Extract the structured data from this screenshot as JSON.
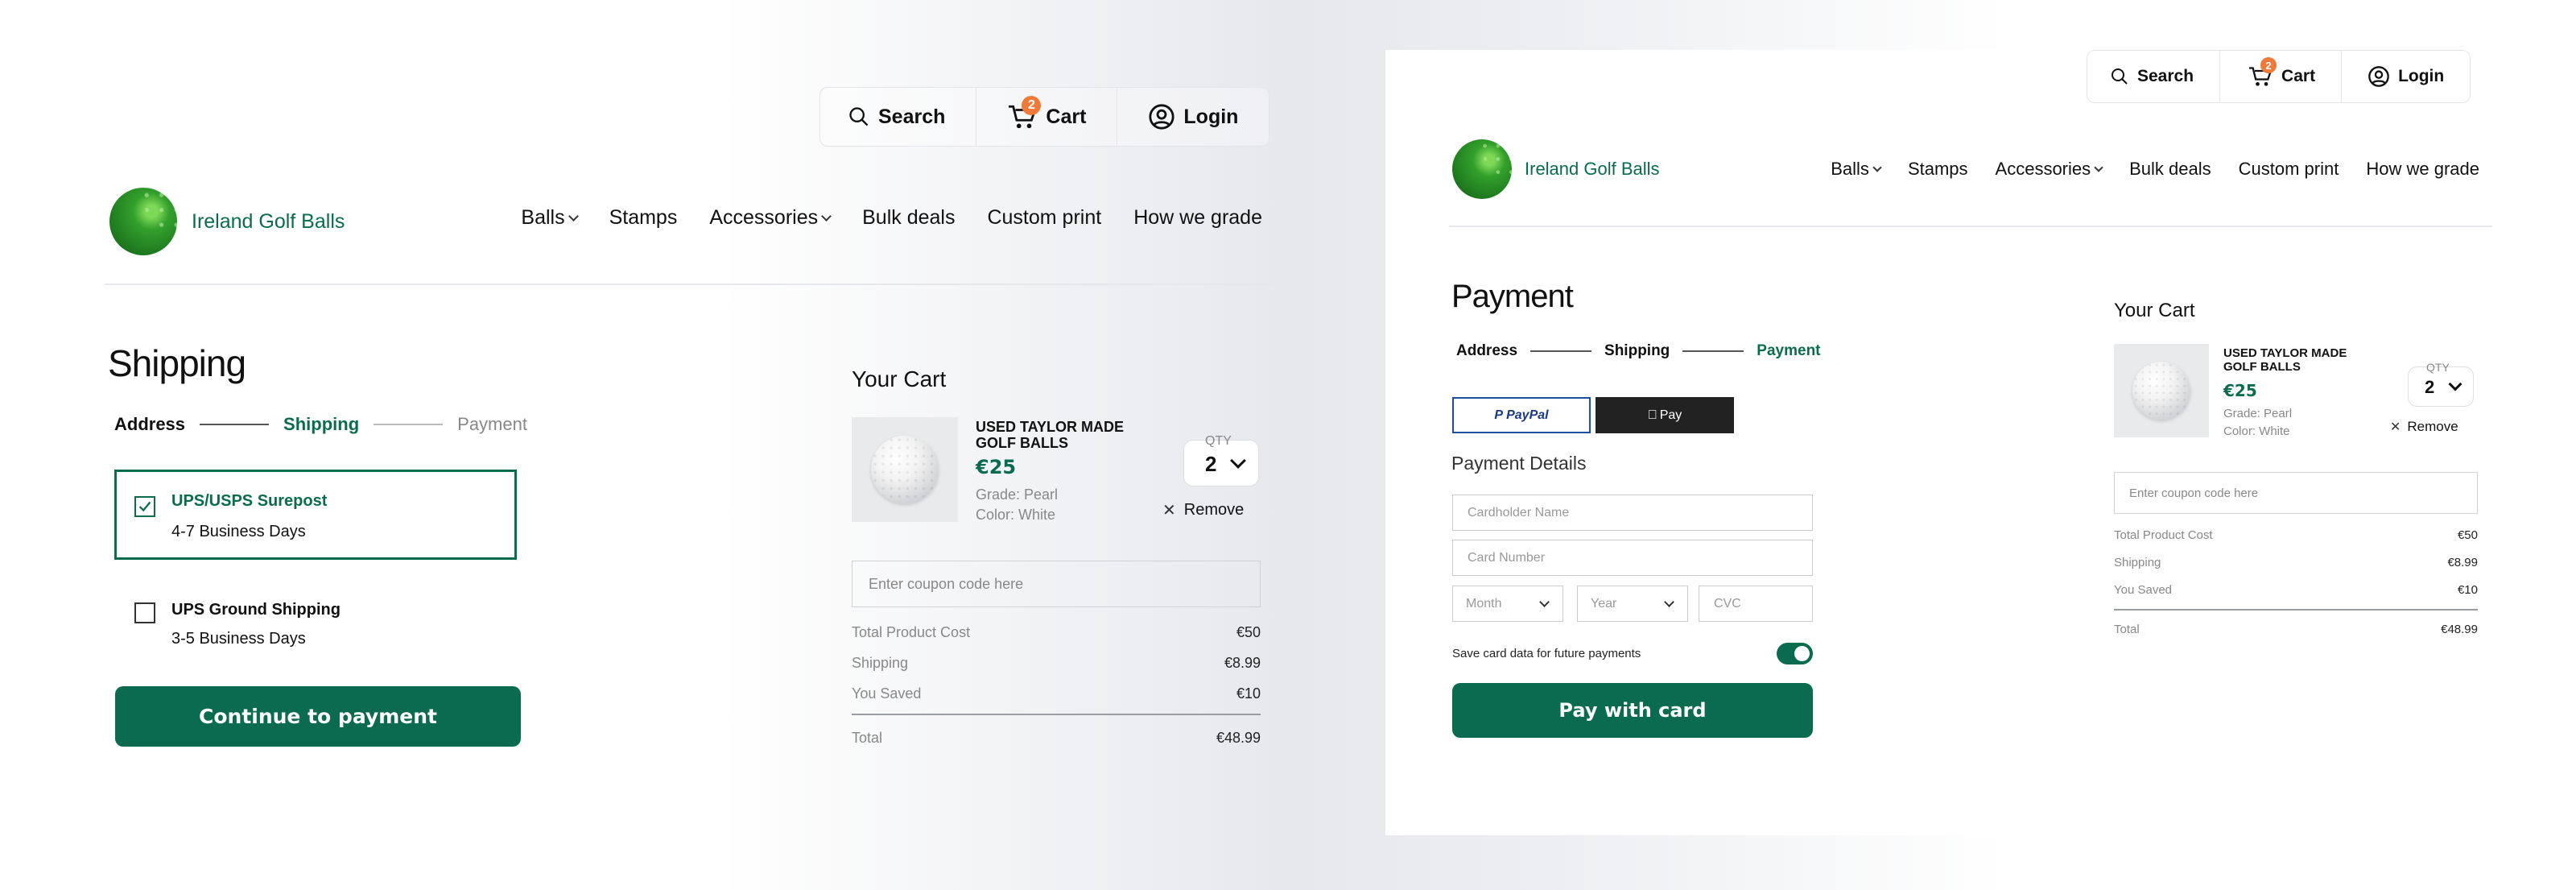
{
  "brand": {
    "name": "Ireland Golf Balls",
    "accent": "#0b6b4f",
    "badge_color": "#f07a3a"
  },
  "topbar": {
    "search": "Search",
    "cart": "Cart",
    "cart_count": "2",
    "login": "Login"
  },
  "nav": {
    "items": [
      {
        "label": "Balls",
        "dropdown": true
      },
      {
        "label": "Stamps",
        "dropdown": false
      },
      {
        "label": "Accessories",
        "dropdown": true
      },
      {
        "label": "Bulk deals",
        "dropdown": false
      },
      {
        "label": "Custom print",
        "dropdown": false
      },
      {
        "label": "How we grade",
        "dropdown": false
      }
    ]
  },
  "left": {
    "title": "Shipping",
    "steps": [
      "Address",
      "Shipping",
      "Payment"
    ],
    "options": [
      {
        "name": "UPS/USPS Surepost",
        "eta": "4-7 Business Days",
        "selected": true
      },
      {
        "name": "UPS Ground Shipping",
        "eta": "3-5 Business Days",
        "selected": false
      }
    ],
    "continue_label": "Continue to payment"
  },
  "cart": {
    "title": "Your Cart",
    "item": {
      "name": "USED TAYLOR MADE GOLF BALLS",
      "price": "€25",
      "grade": "Grade: Pearl",
      "color": "Color: White",
      "qty_label": "QTY",
      "qty": "2",
      "remove": "Remove"
    },
    "coupon_placeholder": "Enter coupon code here",
    "summary": {
      "total_product_cost_label": "Total Product Cost",
      "total_product_cost": "€50",
      "shipping_label": "Shipping",
      "shipping": "€8.99",
      "saved_label": "You Saved",
      "saved": "€10",
      "total_label": "Total",
      "total": "€48.99"
    }
  },
  "right": {
    "title": "Payment",
    "steps": [
      "Address",
      "Shipping",
      "Payment"
    ],
    "paypal": "PayPal",
    "applepay": "Pay",
    "details_title": "Payment Details",
    "fields": {
      "name": "Cardholder Name",
      "number": "Card Number",
      "month": "Month",
      "year": "Year",
      "cvc": "CVC"
    },
    "save_card": "Save card data for future payments",
    "save_card_on": true,
    "pay_label": "Pay with card"
  }
}
